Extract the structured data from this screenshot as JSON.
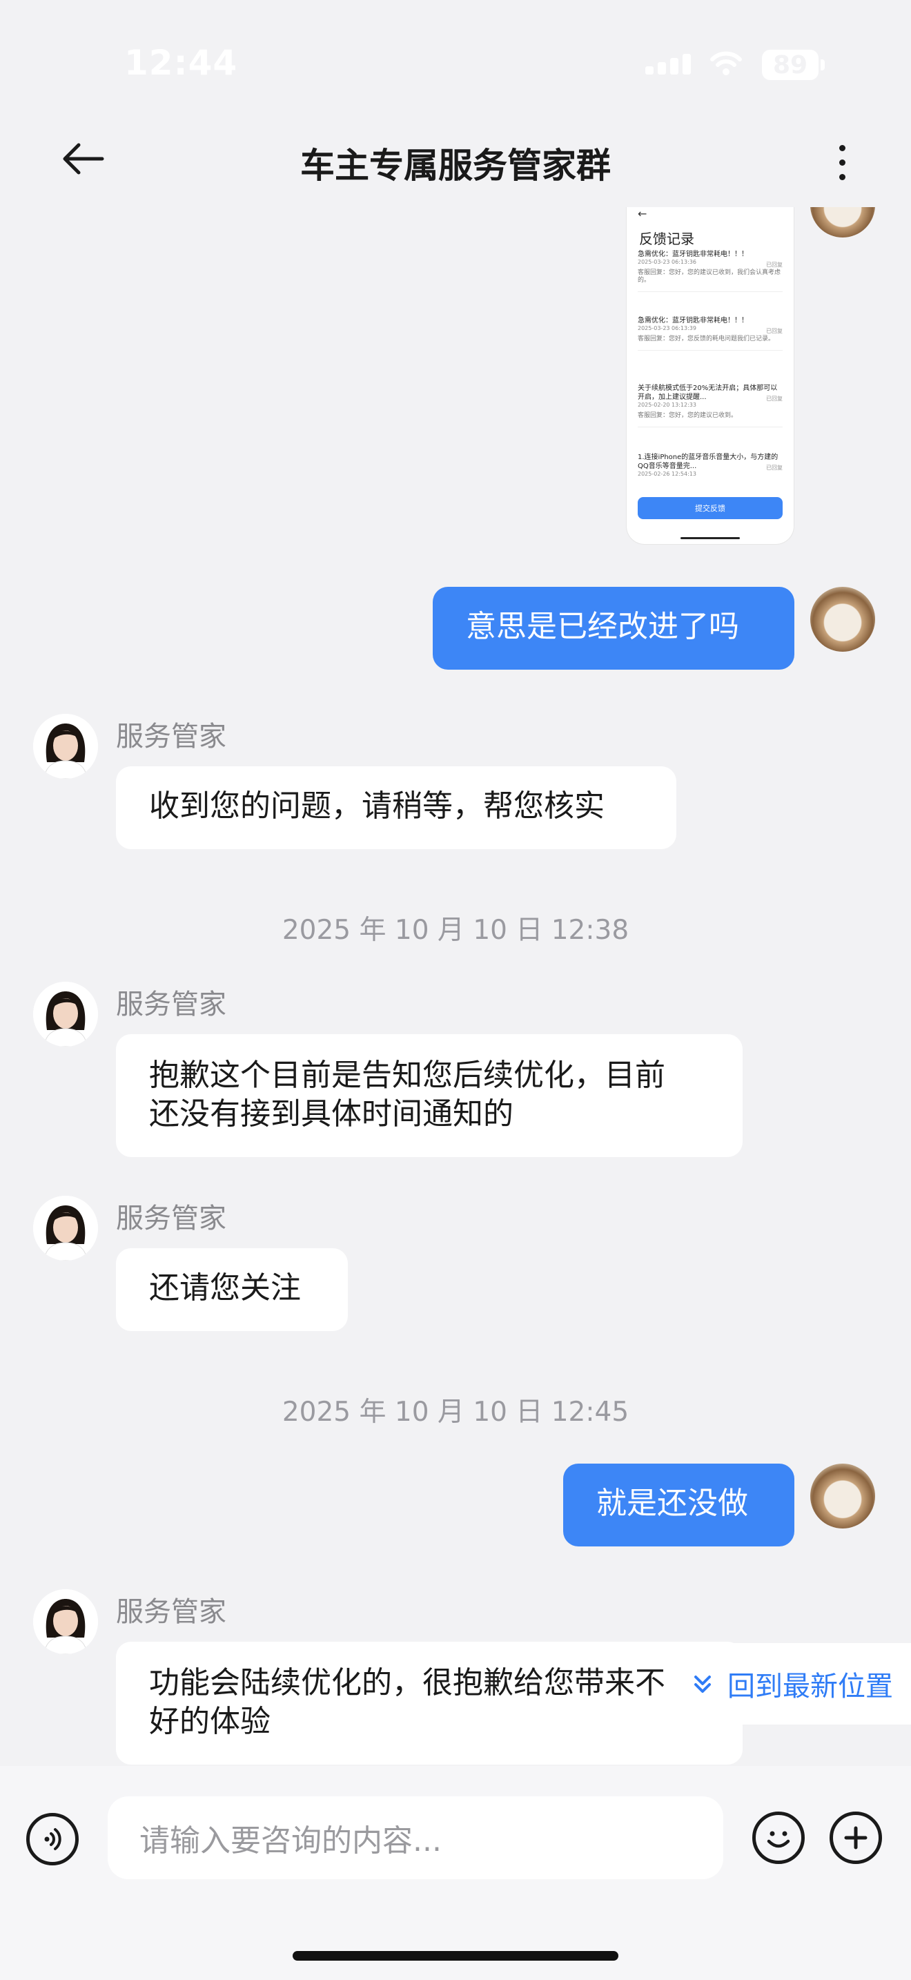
{
  "status_bar": {
    "time": "12:44",
    "battery": "89"
  },
  "header": {
    "title": "车主专属服务管家群"
  },
  "thumbnail": {
    "title": "反馈记录",
    "rows": [
      {
        "title": "急需优化：蓝牙钥匙非常耗电！！！",
        "date": "2025-03-23 06:13:36",
        "tag": "已回复",
        "reply": "客服回复：您好，您的建议已收到，我们会认真考虑的。"
      },
      {
        "title": "急需优化：蓝牙钥匙非常耗电！！！",
        "date": "2025-03-23 06:13:39",
        "tag": "已回复",
        "reply": "客服回复：您好，您反馈的耗电问题我们已记录。"
      },
      {
        "title": "关于续航模式低于20%无法开启；具体那可以开启，加上建议提醒...",
        "date": "2025-02-20 13:12:33",
        "tag": "已回复",
        "reply": "客服回复：您好，您的建议已收到。"
      },
      {
        "title": "1.连接iPhone的蓝牙音乐音量大小，与方建的QQ音乐等音量完...",
        "date": "2025-02-26 12:54:13",
        "tag": "已回复",
        "reply": ""
      }
    ],
    "button": "提交反馈"
  },
  "messages": {
    "user1": "意思是已经改进了吗",
    "agent_name": "服务管家",
    "agent1": "收到您的问题，请稍等，帮您核实",
    "time1": "2025 年 10 月 10 日  12:38",
    "agent2_line1": "抱歉这个目前是告知您后续优化，目前",
    "agent2_line2": "还没有接到具体时间通知的",
    "agent3": "还请您关注",
    "time2": "2025 年 10 月 10 日  12:45",
    "user2": "就是还没做",
    "agent4_line1": "功能会陆续优化的，很抱歉给您带来不",
    "agent4_line2": "好的体验"
  },
  "jump_latest": "回到最新位置",
  "input": {
    "placeholder": "请输入要咨询的内容..."
  },
  "icons": {
    "back": "arrow-left-icon",
    "more": "more-vertical-icon",
    "voice": "voice-icon",
    "emoji": "emoji-icon",
    "plus": "plus-icon",
    "jump": "double-chevron-down-icon"
  },
  "colors": {
    "accent": "#3d86f6",
    "background": "#f2f2f4"
  }
}
